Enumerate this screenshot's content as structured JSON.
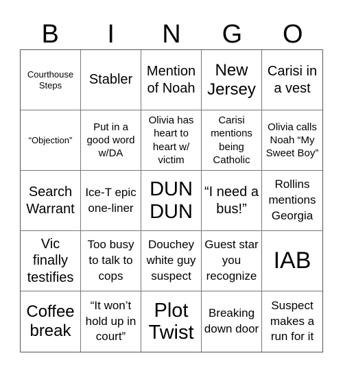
{
  "title_letters": [
    "B",
    "I",
    "N",
    "G",
    "O"
  ],
  "board": {
    "cells": [
      {
        "text": "Courthouse Steps",
        "size": "s-xs"
      },
      {
        "text": "Stabler",
        "size": "s-lg"
      },
      {
        "text": "Mention of Noah",
        "size": "s-lg"
      },
      {
        "text": "New Jersey",
        "size": "s-xl"
      },
      {
        "text": "Carisi in a vest",
        "size": "s-lg"
      },
      {
        "text": "“Objection”",
        "size": "s-xs"
      },
      {
        "text": "Put in a good word w/DA",
        "size": "s-sm"
      },
      {
        "text": "Olivia has heart to heart w/ victim",
        "size": "s-sm"
      },
      {
        "text": "Carisi mentions being Catholic",
        "size": "s-sm"
      },
      {
        "text": "Olivia calls Noah “My Sweet Boy”",
        "size": "s-sm"
      },
      {
        "text": "Search Warrant",
        "size": "s-lg"
      },
      {
        "text": "Ice-T epic one-liner",
        "size": "s-md"
      },
      {
        "text": "DUN DUN",
        "size": "s-xxl"
      },
      {
        "text": "“I need a bus!”",
        "size": "s-lg"
      },
      {
        "text": "Rollins mentions Georgia",
        "size": "s-md"
      },
      {
        "text": "Vic finally testifies",
        "size": "s-lg"
      },
      {
        "text": "Too busy to talk to cops",
        "size": "s-md"
      },
      {
        "text": "Douchey white guy suspect",
        "size": "s-md"
      },
      {
        "text": "Guest star you recognize",
        "size": "s-md"
      },
      {
        "text": "IAB",
        "size": "s-huge"
      },
      {
        "text": "Coffee break",
        "size": "s-xl"
      },
      {
        "text": "“It won’t hold up in court”",
        "size": "s-md"
      },
      {
        "text": "Plot Twist",
        "size": "s-xxl"
      },
      {
        "text": "Breaking down door",
        "size": "s-md"
      },
      {
        "text": "Suspect makes a run for it",
        "size": "s-md"
      }
    ]
  }
}
